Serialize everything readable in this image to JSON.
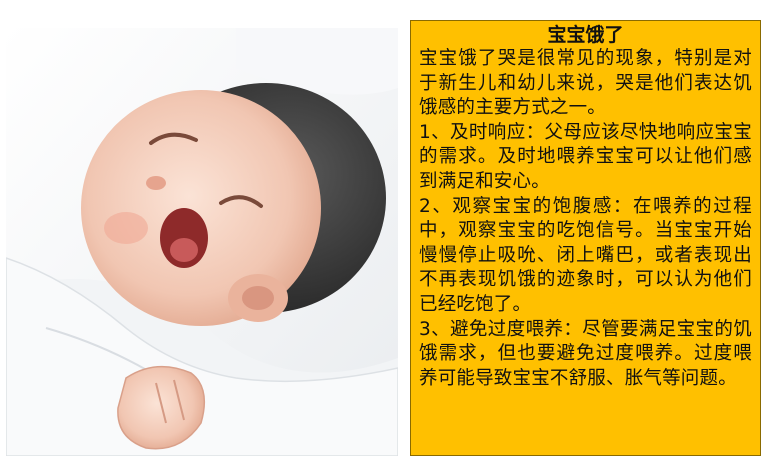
{
  "photo": {
    "subject_icon": "crying-baby-photo"
  },
  "article": {
    "title": "宝宝饿了",
    "intro": "宝宝饿了哭是很常见的现象，特别是对于新生儿和幼儿来说，哭是他们表达饥饿感的主要方式之一。",
    "points": [
      "1、及时响应：父母应该尽快地响应宝宝的需求。及时地喂养宝宝可以让他们感到满足和安心。",
      "2、观察宝宝的饱腹感：在喂养的过程中，观察宝宝的吃饱信号。当宝宝开始慢慢停止吸吮、闭上嘴巴，或者表现出不再表现饥饿的迹象时，可以认为他们已经吃饱了。",
      "3、避免过度喂养：尽管要满足宝宝的饥饿需求，但也要避免过度喂养。过度喂养可能导致宝宝不舒服、胀气等问题。"
    ]
  },
  "colors": {
    "box_background": "#ffc000",
    "text": "#111111"
  }
}
